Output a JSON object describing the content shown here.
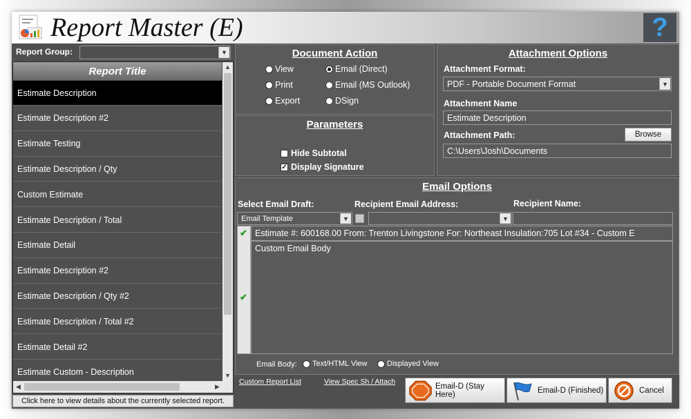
{
  "app": {
    "title": "Report Master (E)"
  },
  "left": {
    "report_group_label": "Report Group:",
    "report_group_value": "",
    "list_header": "Report Title",
    "items": [
      "Estimate Description",
      "Estimate Description #2",
      "Estimate Testing",
      "Estimate Description / Qty",
      "Custom Estimate",
      "Estimate Description / Total",
      "Estimate Detail",
      "Estimate Description #2",
      "Estimate Description / Qty #2",
      "Estimate Description / Total #2",
      "Estimate Detail #2",
      "Estimate Custom - Description"
    ],
    "selected_index": 0,
    "footer": "Click here to view details about the currently selected report."
  },
  "document_action": {
    "title": "Document Action",
    "options": [
      "View",
      "Email (Direct)",
      "Print",
      "Email (MS Outlook)",
      "Export",
      "DSign"
    ],
    "selected": "Email (Direct)"
  },
  "parameters": {
    "title": "Parameters",
    "hide_subtotal": {
      "label": "Hide Subtotal",
      "checked": false
    },
    "display_signature": {
      "label": "Display Signature",
      "checked": true
    }
  },
  "attachment": {
    "title": "Attachment Options",
    "format_label": "Attachment Format:",
    "format_value": "PDF - Portable Document Format",
    "name_label": "Attachment Name",
    "name_value": "Estimate Description",
    "path_label": "Attachment Path:",
    "path_value": "C:\\Users\\Josh\\Documents",
    "browse_label": "Browse"
  },
  "email": {
    "title": "Email Options",
    "draft_label": "Select Email Draft:",
    "recipient_address_label": "Recipient Email Address:",
    "recipient_name_label": "Recipient Name:",
    "draft_value": "Email Template",
    "recipient_address_value": "",
    "recipient_name_value": "",
    "subject": "Estimate #: 600168.00   From: Trenton Livingstone   For: Northeast Insulation:705 Lot #34   -   Custom E",
    "body": "Custom Email Body",
    "body_mode_label": "Email Body:",
    "body_mode_options": [
      "Text/HTML View",
      "Displayed View"
    ],
    "body_mode_selected": ""
  },
  "footer": {
    "custom_report_list": "Custom Report List",
    "view_spec": "View Spec Sh / Attach",
    "email_stay": "Email-D (Stay Here)",
    "email_finished": "Email-D (Finished)",
    "cancel": "Cancel"
  },
  "colors": {
    "window_bg": "#4f4f4f",
    "panel_bg": "#5a5a5a",
    "selected_row": "#000000",
    "help_icon": "#3aa0e6",
    "stop_icon": "#e86a1c"
  }
}
